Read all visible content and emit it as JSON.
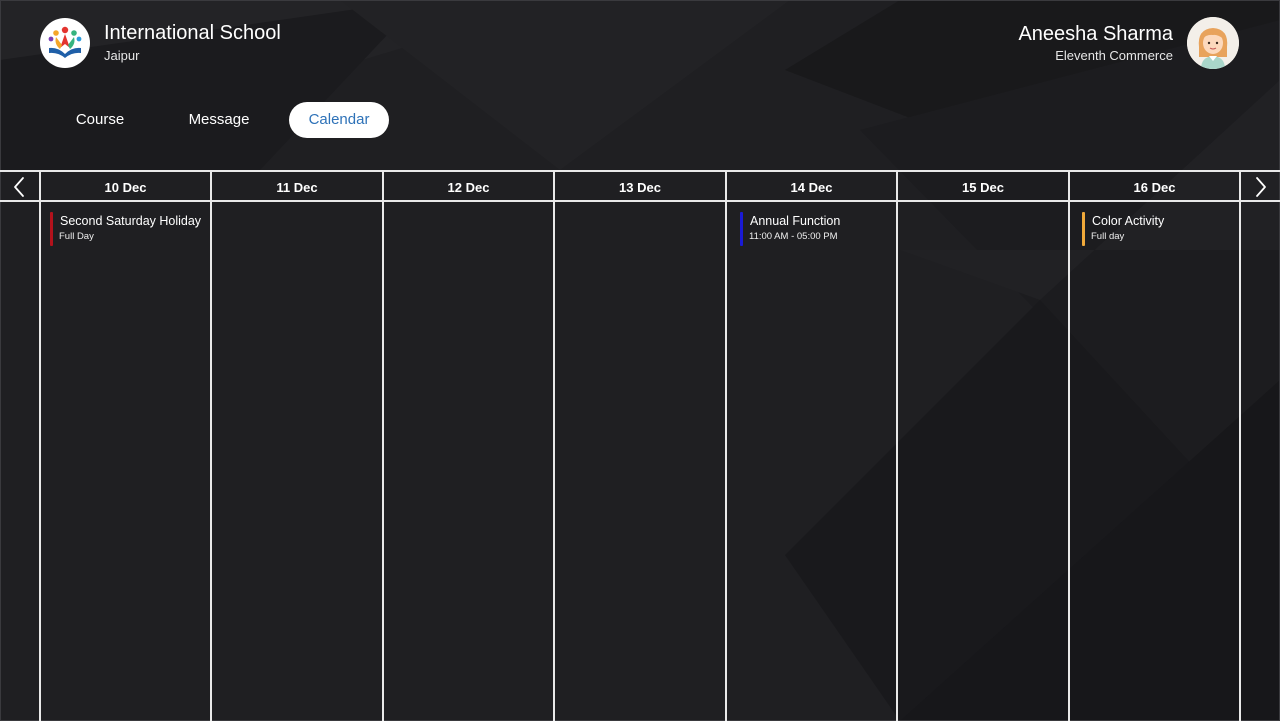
{
  "school": {
    "name": "International School",
    "city": "Jaipur",
    "logo_icon": "school-logo-icon"
  },
  "user": {
    "name": "Aneesha Sharma",
    "class": "Eleventh Commerce",
    "avatar_icon": "student-avatar-icon"
  },
  "tabs": [
    {
      "label": "Course",
      "active": false
    },
    {
      "label": "Message",
      "active": false
    },
    {
      "label": "Calendar",
      "active": true
    }
  ],
  "calendar": {
    "prev_icon": "chevron-left-icon",
    "next_icon": "chevron-right-icon",
    "days": [
      {
        "label": "10 Dec"
      },
      {
        "label": "11 Dec"
      },
      {
        "label": "12 Dec"
      },
      {
        "label": "13 Dec"
      },
      {
        "label": "14 Dec"
      },
      {
        "label": "15 Dec"
      },
      {
        "label": "16 Dec"
      }
    ],
    "events": [
      {
        "day": "10 Dec",
        "title": "Second Saturday Holiday",
        "time": "Full Day",
        "color": "#b3121c"
      },
      {
        "day": "14 Dec",
        "title": "Annual Function",
        "time": "11:00 AM - 05:00 PM",
        "color": "#1a1ad6"
      },
      {
        "day": "16 Dec",
        "title": "Color Activity",
        "time": "Full day",
        "color": "#f0a93a"
      }
    ]
  },
  "colors": {
    "background": "#1f1f22",
    "grid_line": "#e9e9e9",
    "active_tab_bg": "#ffffff",
    "active_tab_text": "#2e72b8"
  }
}
